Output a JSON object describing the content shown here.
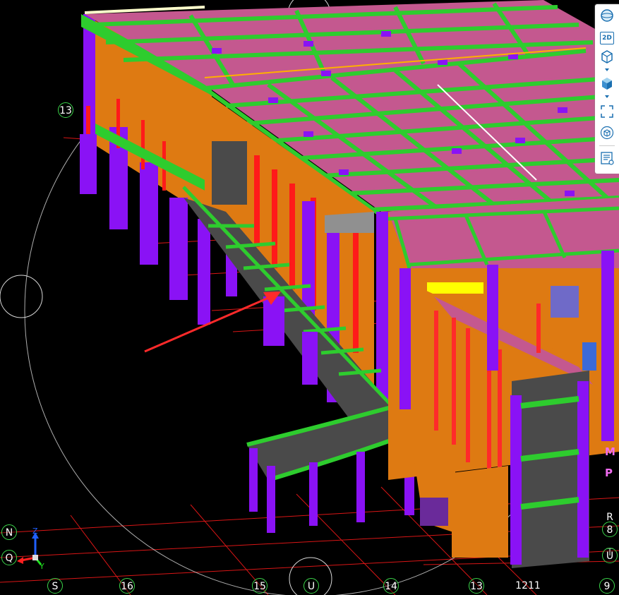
{
  "viewport": {
    "background": "#000000",
    "colors": {
      "slab": "#c4588f",
      "beam": "#2ecc2e",
      "column": "#8a12f5",
      "wall": "#de7a12",
      "stair": "#4a4a4a",
      "grid": "#ff1a1a",
      "rebar": "#ff2020",
      "highlight_yellow": "#ffff00"
    }
  },
  "grid_labels": {
    "left_13": "13",
    "n": "N",
    "q": "Q",
    "s": "S",
    "g16": "16",
    "g15": "15",
    "u_bottom": "U",
    "g14": "14",
    "g13b": "13",
    "g12_11": "1211",
    "g9": "9",
    "r": "R",
    "g8": "8",
    "t": "T",
    "u_right": "U"
  },
  "nav_cube": {
    "m": "M",
    "p": "P"
  },
  "triad": {
    "z": "Z",
    "y": "Y"
  },
  "toolbar": {
    "items": [
      {
        "name": "orbit",
        "icon": "sphere-icon"
      },
      {
        "name": "2d",
        "label": "2D",
        "icon": "2d-view-icon"
      },
      {
        "name": "view-cube",
        "icon": "outline-cube-icon"
      },
      {
        "name": "shaded-cube",
        "icon": "shaded-cube-icon"
      },
      {
        "name": "fit",
        "icon": "fit-frame-icon"
      },
      {
        "name": "isolate",
        "icon": "cube-target-icon"
      },
      {
        "name": "properties",
        "icon": "properties-panel-icon"
      }
    ]
  }
}
